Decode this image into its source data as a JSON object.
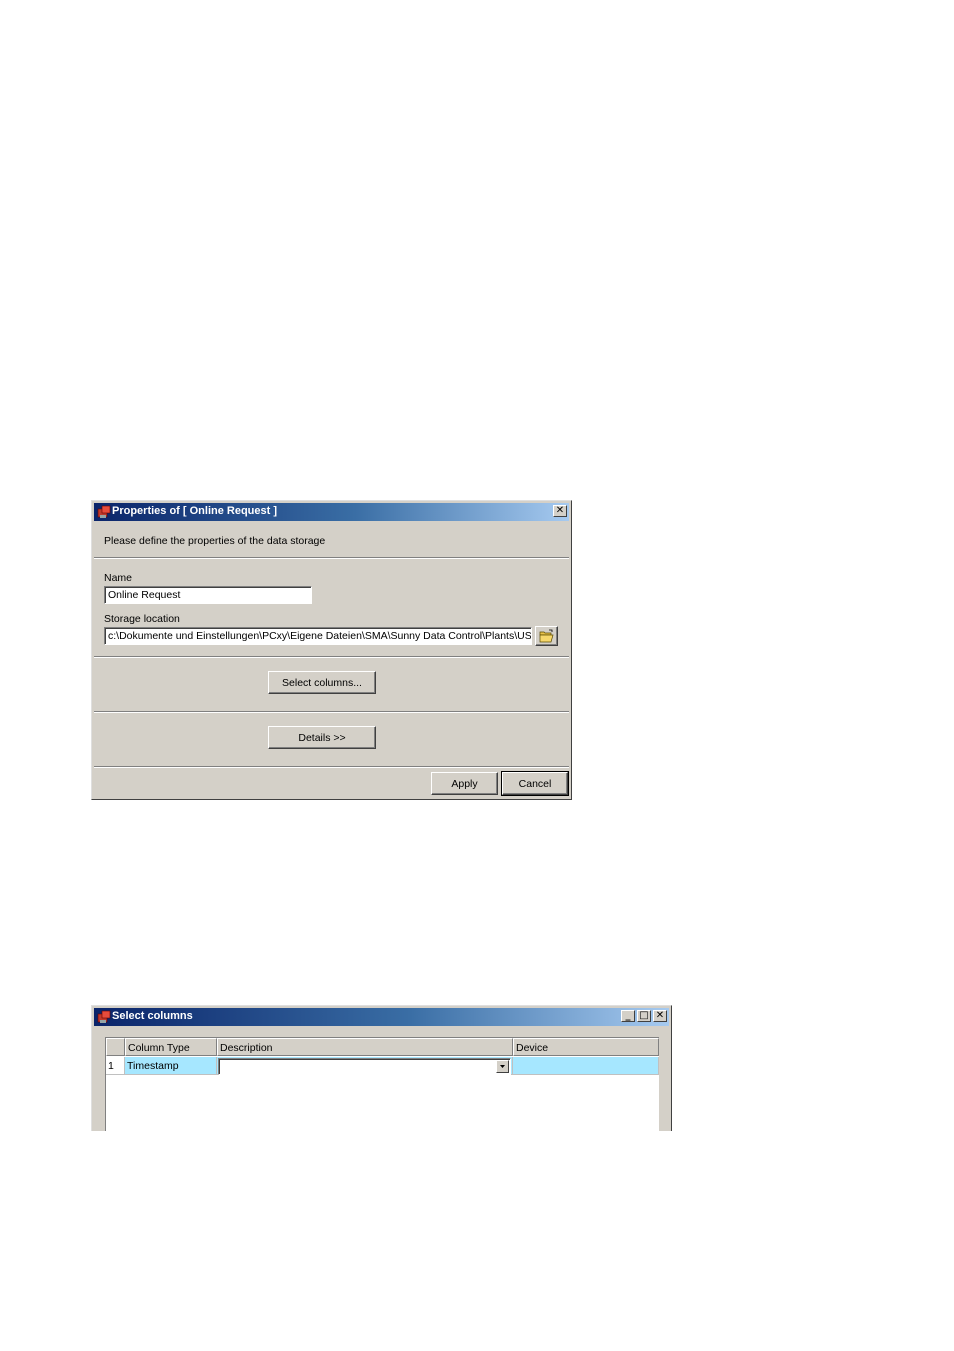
{
  "properties_dialog": {
    "title": "Properties of [ Online Request ]",
    "instruction": "Please define the properties of the data storage",
    "name_label": "Name",
    "name_value": "Online Request",
    "storage_label": "Storage location",
    "storage_value": "c:\\Dokumente und Einstellungen\\PCxy\\Eigene Dateien\\SMA\\Sunny Data Control\\Plants\\USB-S\\",
    "select_columns_label": "Select columns...",
    "details_label": "Details >>",
    "apply_label": "Apply",
    "cancel_label": "Cancel",
    "close_glyph": "✕"
  },
  "select_columns_dialog": {
    "title": "Select columns",
    "minimize_glyph": "_",
    "maximize_glyph": "□",
    "close_glyph": "✕",
    "columns": [
      "Column Type",
      "Description",
      "Device"
    ],
    "rows": [
      {
        "index": "1",
        "column_type": "Timestamp",
        "description": "",
        "device": ""
      }
    ]
  },
  "icons": {
    "app": "app-icon",
    "folder": "folder-open-icon",
    "dropdown": "chevron-down-icon"
  }
}
